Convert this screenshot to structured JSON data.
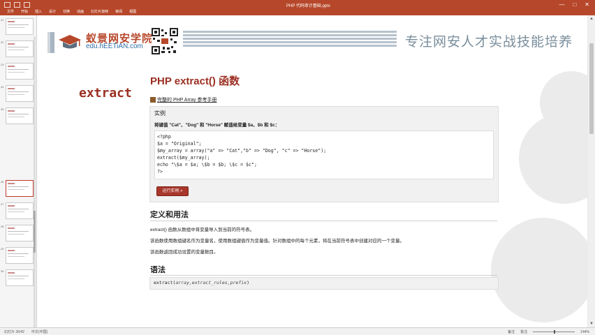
{
  "titlebar": {
    "doc_title": "PHP 代码审计基础.pptx",
    "tabs": [
      "文件",
      "开始",
      "插入",
      "设计",
      "切换",
      "动画",
      "幻灯片放映",
      "审阅",
      "视图"
    ],
    "min": "—",
    "max": "□",
    "close": "✕"
  },
  "thumbnails": {
    "numbers": [
      "21",
      "22",
      "23",
      "24",
      "25",
      "26",
      "27",
      "28",
      "29",
      "30"
    ],
    "selected_index": 5
  },
  "slide": {
    "brand_cn": "蚁景网安学院",
    "brand_en": "edu.hEETiAN.com",
    "slogan": "专注网安人才实战技能培养",
    "big_word": "extract",
    "title": "PHP extract() 函数",
    "manual_link": "完整的 PHP Array 参考手册",
    "example": {
      "heading": "实例",
      "description": "将键值 \"Cat\"、\"Dog\" 和 \"Horse\" 赋值给变量 $a、$b 和 $c：",
      "code": [
        "<?php",
        "$a = \"Original\";",
        "$my_array = array(\"a\" => \"Cat\",\"b\" => \"Dog\", \"c\" => \"Horse\");",
        "extract($my_array);",
        "echo \"\\$a = $a; \\$b = $b; \\$c = $c\";",
        "?>"
      ],
      "run_button": "运行实例 »"
    },
    "definition": {
      "heading": "定义和用法",
      "paragraphs": [
        "extract() 函数从数组中将变量导入到当前的符号表。",
        "该函数使用数组键名作为变量名，使用数组键值作为变量值。针对数组中的每个元素，将在当前符号表中创建对应的一个变量。",
        "该函数返回成功设置的变量数目。"
      ]
    },
    "syntax": {
      "heading": "语法",
      "fn": "extract(",
      "args": "array,extract_rules,prefix",
      "close": ")"
    }
  },
  "statusbar": {
    "slide_info": "幻灯片 26/42",
    "language": "中文(中国)",
    "notes": "备注",
    "comments": "批注",
    "zoom": "144%"
  },
  "colors": {
    "accent": "#b7472a",
    "heading_red": "#9b2f22",
    "brand_blue": "#2e6da4",
    "slogan_gray": "#7a8e9c"
  }
}
